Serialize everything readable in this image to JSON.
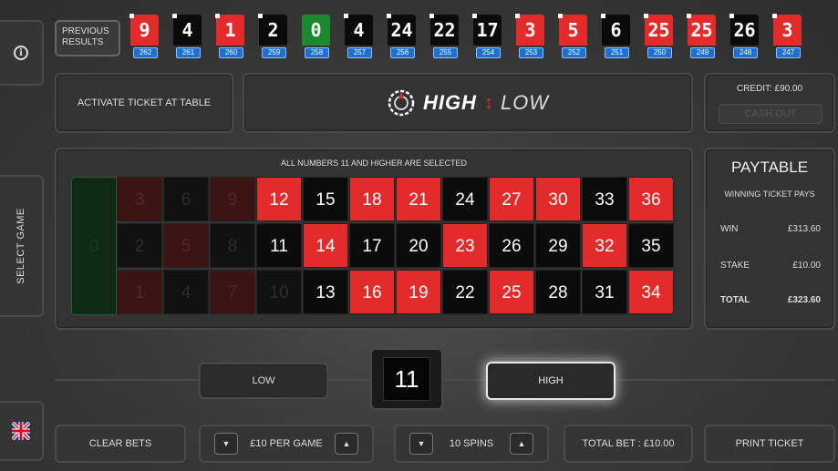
{
  "sidebar": {
    "select_game_label": "SELECT GAME"
  },
  "previous_results": {
    "label": "PREVIOUS RESULTS",
    "items": [
      {
        "number": "9",
        "color": "red",
        "game": "262"
      },
      {
        "number": "4",
        "color": "black",
        "game": "261"
      },
      {
        "number": "1",
        "color": "red",
        "game": "260"
      },
      {
        "number": "2",
        "color": "black",
        "game": "259"
      },
      {
        "number": "0",
        "color": "green",
        "game": "258"
      },
      {
        "number": "4",
        "color": "black",
        "game": "257"
      },
      {
        "number": "24",
        "color": "black",
        "game": "256"
      },
      {
        "number": "22",
        "color": "black",
        "game": "255"
      },
      {
        "number": "17",
        "color": "black",
        "game": "254"
      },
      {
        "number": "3",
        "color": "red",
        "game": "253"
      },
      {
        "number": "5",
        "color": "red",
        "game": "252"
      },
      {
        "number": "6",
        "color": "black",
        "game": "251"
      },
      {
        "number": "25",
        "color": "red",
        "game": "250"
      },
      {
        "number": "25",
        "color": "red",
        "game": "249"
      },
      {
        "number": "26",
        "color": "black",
        "game": "248"
      },
      {
        "number": "3",
        "color": "red",
        "game": "247"
      }
    ]
  },
  "header": {
    "activate_label": "ACTIVATE TICKET AT TABLE",
    "logo_high": "HIGH",
    "logo_low": "LOW",
    "credit_label": "CREDIT: £90.00",
    "cashout_label": "CASH OUT"
  },
  "board": {
    "caption": "ALL NUMBERS 11 AND HIGHER ARE SELECTED",
    "zero": "0",
    "rows": [
      [
        "3",
        "6",
        "9",
        "12",
        "15",
        "18",
        "21",
        "24",
        "27",
        "30",
        "33",
        "36"
      ],
      [
        "2",
        "5",
        "8",
        "11",
        "14",
        "17",
        "20",
        "23",
        "26",
        "29",
        "32",
        "35"
      ],
      [
        "1",
        "4",
        "7",
        "10",
        "13",
        "16",
        "19",
        "22",
        "25",
        "28",
        "31",
        "34"
      ]
    ],
    "red_numbers": [
      "1",
      "3",
      "5",
      "7",
      "9",
      "12",
      "14",
      "16",
      "18",
      "19",
      "21",
      "23",
      "25",
      "27",
      "30",
      "32",
      "34",
      "36"
    ],
    "threshold": 11
  },
  "paytable": {
    "title": "PAYTABLE",
    "subtitle": "WINNING TICKET PAYS",
    "rows": [
      {
        "label": "WIN",
        "value": "£313.60"
      },
      {
        "label": "STAKE",
        "value": "£10.00"
      },
      {
        "label": "TOTAL",
        "value": "£323.60"
      }
    ]
  },
  "selection": {
    "low_label": "LOW",
    "high_label": "HIGH",
    "selected_number": "11",
    "active": "high"
  },
  "bottom": {
    "clear_bets": "CLEAR BETS",
    "per_game": "£10 PER GAME",
    "spins": "10 SPINS",
    "total_bet": "TOTAL BET : £10.00",
    "print_ticket": "PRINT TICKET"
  },
  "colors": {
    "red": "#e32b2b",
    "black": "#0b0b0b",
    "green": "#1b8a2e",
    "game_badge": "#1d6fd1"
  },
  "icons": {
    "info": "info-icon",
    "flag": "uk-flag-icon",
    "decrease": "triangle-down-icon",
    "increase": "triangle-up-icon",
    "logo": "roulette-wheel-icon"
  }
}
